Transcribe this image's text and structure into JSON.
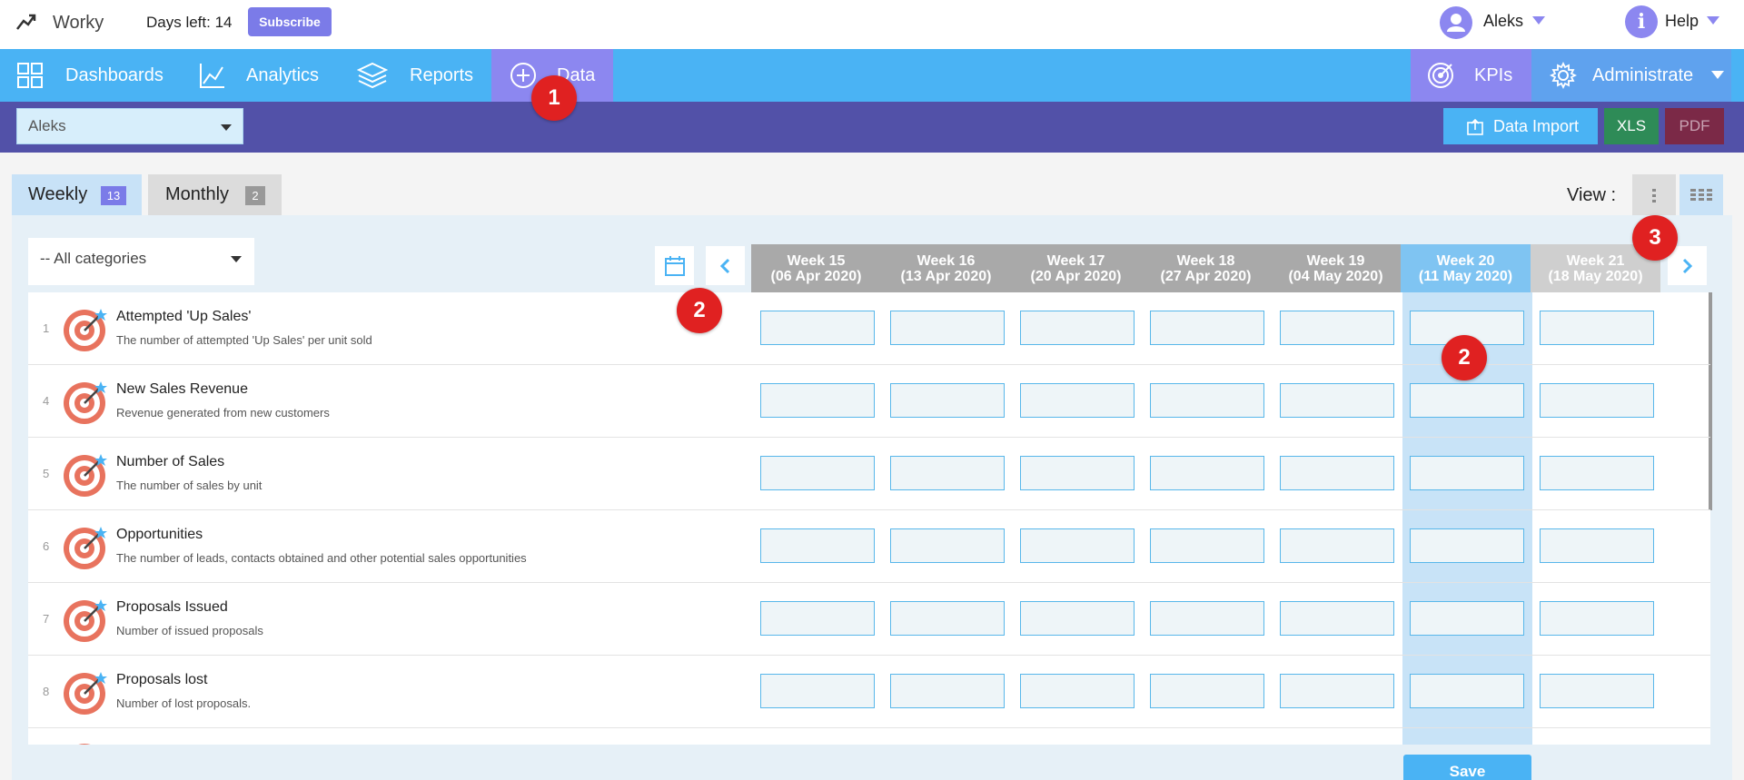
{
  "app": {
    "name": "Worky",
    "days_left": "Days left: 14",
    "subscribe": "Subscribe"
  },
  "user_menu": {
    "name": "Aleks",
    "help": "Help",
    "help_glyph": "i"
  },
  "nav": {
    "dashboards": "Dashboards",
    "analytics": "Analytics",
    "reports": "Reports",
    "data": "Data",
    "kpis": "KPIs",
    "administrate": "Administrate"
  },
  "subbar": {
    "user_select": "Aleks",
    "data_import": "Data Import",
    "xls": "XLS",
    "pdf": "PDF"
  },
  "tabs": [
    {
      "label": "Weekly",
      "count": "13"
    },
    {
      "label": "Monthly",
      "count": "2"
    }
  ],
  "view": {
    "label": "View :"
  },
  "filter": {
    "category": "-- All categories"
  },
  "weeks": [
    {
      "week": "Week 15",
      "date": "(06 Apr 2020)"
    },
    {
      "week": "Week 16",
      "date": "(13 Apr 2020)"
    },
    {
      "week": "Week 17",
      "date": "(20 Apr 2020)"
    },
    {
      "week": "Week 18",
      "date": "(27 Apr 2020)"
    },
    {
      "week": "Week 19",
      "date": "(04 May 2020)"
    },
    {
      "week": "Week 20",
      "date": "(11 May 2020)"
    },
    {
      "week": "Week 21",
      "date": "(18 May 2020)"
    }
  ],
  "kpis": [
    {
      "num": "1",
      "title": "Attempted 'Up Sales'",
      "desc": "The number of attempted 'Up Sales' per unit sold"
    },
    {
      "num": "4",
      "title": "New Sales Revenue",
      "desc": "Revenue generated from new customers"
    },
    {
      "num": "5",
      "title": "Number of Sales",
      "desc": "The number of sales by unit"
    },
    {
      "num": "6",
      "title": "Opportunities",
      "desc": "The number of leads, contacts obtained and other potential sales opportunities"
    },
    {
      "num": "7",
      "title": "Proposals Issued",
      "desc": "Number of issued proposals"
    },
    {
      "num": "8",
      "title": "Proposals lost",
      "desc": "Number of lost proposals."
    }
  ],
  "actions": {
    "save": "Save"
  },
  "markers": [
    "1",
    "2",
    "2",
    "3"
  ],
  "colors": {
    "nav_blue": "#4ab3f4",
    "purple": "#8c87f0",
    "sub_bar": "#5251a8",
    "marker_red": "#e02121",
    "target_red": "#e8735e"
  }
}
